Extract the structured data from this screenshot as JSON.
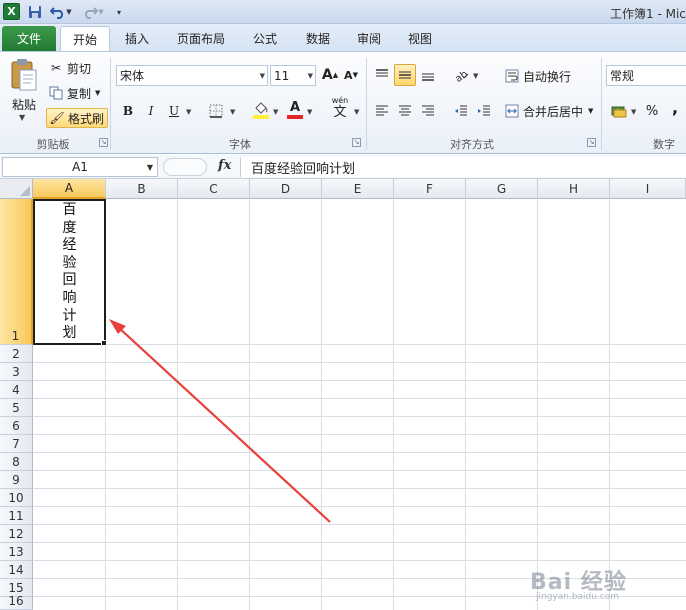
{
  "title_bar": {
    "window_title": "工作簿1 - Mic",
    "app_icon_letter": "X"
  },
  "ribbon_tabs": {
    "file": "文件",
    "home": "开始",
    "insert": "插入",
    "page_layout": "页面布局",
    "formulas": "公式",
    "data": "数据",
    "review": "审阅",
    "view": "视图",
    "active": "开始"
  },
  "clipboard": {
    "paste": "粘贴",
    "cut": "剪切",
    "copy": "复制",
    "format_painter": "格式刷",
    "group_label": "剪贴板"
  },
  "font": {
    "font_name": "宋体",
    "font_size": "11",
    "bold": "B",
    "italic": "I",
    "underline": "U",
    "group_label": "字体",
    "grow": "A",
    "shrink": "A",
    "color_letter": "A",
    "wen": "wén",
    "wen_char": "文"
  },
  "alignment": {
    "wrap_text": "自动换行",
    "merge_center": "合并后居中",
    "group_label": "对齐方式"
  },
  "number": {
    "format": "常规",
    "percent": "%",
    "comma": ",",
    "group_label": "数字"
  },
  "formula_bar": {
    "name_box": "A1",
    "fx": "fx",
    "content": "百度经验回响计划"
  },
  "grid": {
    "columns": [
      "A",
      "B",
      "C",
      "D",
      "E",
      "F",
      "G",
      "H",
      "I"
    ],
    "rows": [
      "1",
      "2",
      "3",
      "4",
      "5",
      "6",
      "7",
      "8",
      "9",
      "10",
      "11",
      "12",
      "13",
      "14",
      "15",
      "16"
    ],
    "active_cell": "A1",
    "cell_a1_chars": [
      "百",
      "度",
      "经",
      "验",
      "回",
      "响",
      "计",
      "划"
    ]
  },
  "annotation": {
    "arrow_color": "#e8403a"
  },
  "watermark": {
    "main": "Bai 经验",
    "sub": "jingyan.baidu.com"
  },
  "colors": {
    "file_tab": "#2e8b3e",
    "selection_header": "#f7c95b",
    "fill_highlight": "#ffef3a",
    "font_color_bar": "#e32626"
  }
}
